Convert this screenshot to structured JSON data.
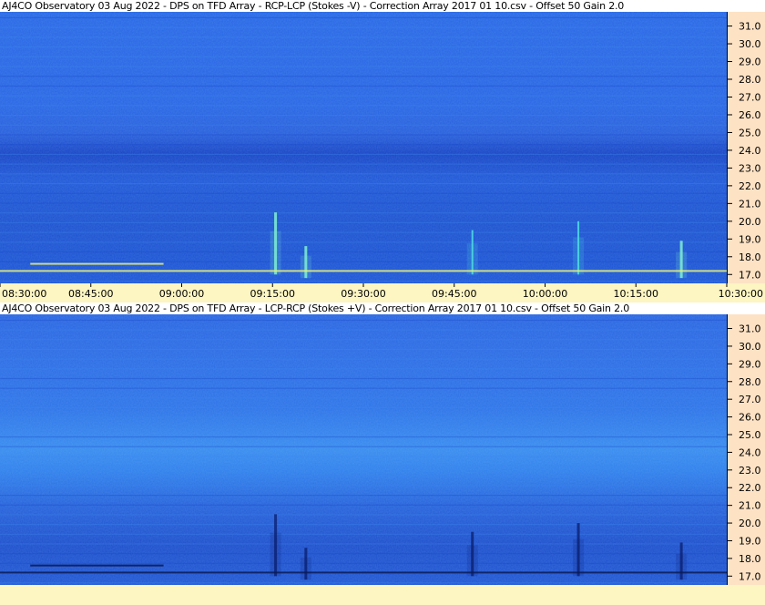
{
  "colors": {
    "background": "#ffffff",
    "axis_panel": "#fde2c4",
    "time_strip": "#fdf5c2",
    "spectro_base": "#1f5fe0",
    "spectro_dark_band": "#1540c4",
    "burst_bright": "#4fe0e0",
    "burst_dark": "#0a1e6e",
    "tick": "#000000"
  },
  "chart_data": [
    {
      "type": "heatmap",
      "title": "AJ4CO Observatory 03 Aug 2022  -  DPS on TFD Array  -  RCP-LCP (Stokes -V)  -  Correction Array 2017 01 10.csv  -  Offset 50  Gain 2.0",
      "xlabel": "",
      "ylabel": "",
      "x_ticks": [
        "08:30:00",
        "08:45:00",
        "09:00:00",
        "09:15:00",
        "09:30:00",
        "09:45:00",
        "10:00:00",
        "10:15:00",
        "10:30:00"
      ],
      "x_range": [
        "08:30:00",
        "10:30:00"
      ],
      "y_ticks": [
        31.0,
        30.0,
        29.0,
        28.0,
        27.0,
        26.0,
        25.0,
        24.0,
        23.0,
        22.0,
        21.0,
        20.0,
        19.0,
        18.0,
        17.0
      ],
      "y_tick_labels": [
        "31.0",
        "30.0",
        "29.0",
        "28.0",
        "27.0",
        "26.0",
        "25.0",
        "24.0",
        "23.0",
        "22.0",
        "21.0",
        "20.0",
        "19.0",
        "18.0",
        "17.0"
      ],
      "y_range": [
        16.5,
        31.8
      ],
      "colormap": "blue-cyan",
      "bursts": [
        {
          "time": "09:15:30",
          "freq_low": 17.0,
          "freq_high": 20.5,
          "intensity": "bright"
        },
        {
          "time": "09:20:30",
          "freq_low": 16.8,
          "freq_high": 18.6,
          "intensity": "bright"
        },
        {
          "time": "09:48:00",
          "freq_low": 17.0,
          "freq_high": 19.5,
          "intensity": "moderate"
        },
        {
          "time": "10:05:30",
          "freq_low": 17.0,
          "freq_high": 20.0,
          "intensity": "moderate"
        },
        {
          "time": "10:22:30",
          "freq_low": 16.8,
          "freq_high": 18.9,
          "intensity": "bright"
        }
      ],
      "horizontal_lines": [
        {
          "freq": 17.2,
          "from": "08:30:00",
          "to": "10:30:00"
        },
        {
          "freq": 17.6,
          "from": "08:35:00",
          "to": "08:57:00"
        }
      ]
    },
    {
      "type": "heatmap",
      "title": "AJ4CO Observatory 03 Aug 2022  -  DPS on TFD Array  -  LCP-RCP (Stokes +V)  -  Correction Array 2017 01 10.csv  -  Offset 50  Gain 2.0",
      "xlabel": "",
      "ylabel": "",
      "y_ticks": [
        31.0,
        30.0,
        29.0,
        28.0,
        27.0,
        26.0,
        25.0,
        24.0,
        23.0,
        22.0,
        21.0,
        20.0,
        19.0,
        18.0,
        17.0
      ],
      "y_tick_labels": [
        "31.0",
        "30.0",
        "29.0",
        "28.0",
        "27.0",
        "26.0",
        "25.0",
        "24.0",
        "23.0",
        "22.0",
        "21.0",
        "20.0",
        "19.0",
        "18.0",
        "17.0"
      ],
      "y_range": [
        16.5,
        31.8
      ],
      "x_range": [
        "08:30:00",
        "10:30:00"
      ],
      "colormap": "blue-cyan",
      "bursts": [
        {
          "time": "09:15:30",
          "freq_low": 17.0,
          "freq_high": 20.5,
          "intensity": "dark"
        },
        {
          "time": "09:20:30",
          "freq_low": 16.8,
          "freq_high": 18.6,
          "intensity": "dark"
        },
        {
          "time": "09:48:00",
          "freq_low": 17.0,
          "freq_high": 19.5,
          "intensity": "dark"
        },
        {
          "time": "10:05:30",
          "freq_low": 17.0,
          "freq_high": 20.0,
          "intensity": "dark"
        },
        {
          "time": "10:22:30",
          "freq_low": 16.8,
          "freq_high": 18.9,
          "intensity": "dark"
        }
      ],
      "horizontal_lines": [
        {
          "freq": 17.2,
          "from": "08:30:00",
          "to": "10:30:00"
        },
        {
          "freq": 17.6,
          "from": "08:35:00",
          "to": "08:57:00"
        }
      ]
    }
  ]
}
